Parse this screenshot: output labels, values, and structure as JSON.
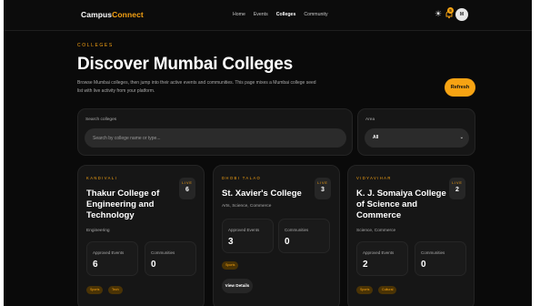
{
  "nav": {
    "brand_part1": "Campus",
    "brand_part2": "Connect",
    "links": [
      "Home",
      "Events",
      "Colleges",
      "Community"
    ],
    "active_link": "Colleges",
    "notification_count": "5",
    "avatar_initial": "M",
    "theme_icon": "sun-icon",
    "bell_icon": "bell-icon"
  },
  "header": {
    "eyebrow": "COLLEGES",
    "title": "Discover Mumbai Colleges",
    "description": "Browse Mumbai colleges, then jump into their active events and communities. This page mixes a Mumbai college seed list with live activity from your platform.",
    "refresh_label": "Refresh"
  },
  "filters": {
    "search_label": "Search colleges",
    "search_placeholder": "Search by college name or type...",
    "area_label": "Area",
    "area_value": "All"
  },
  "colors": {
    "accent": "#f7a313",
    "background": "#0a0a0a",
    "card": "#161616"
  },
  "colleges": [
    {
      "area": "KANDIVALI",
      "name": "Thakur College of Engineering and Technology",
      "type": "Engineering",
      "live_label": "LIVE",
      "live_count": "6",
      "approved_label": "Approved Events",
      "approved_value": "6",
      "communities_label": "Communities",
      "communities_value": "0",
      "tags": [
        "Sports",
        "Tech"
      ]
    },
    {
      "area": "DHOBI TALAO",
      "name": "St. Xavier's College",
      "type": "Arts, Science, Commerce",
      "live_label": "LIVE",
      "live_count": "3",
      "approved_label": "Approved Events",
      "approved_value": "3",
      "communities_label": "Communities",
      "communities_value": "0",
      "tags": [
        "Sports"
      ],
      "view_label": "View Details"
    },
    {
      "area": "VIDYAVIHAR",
      "name": "K. J. Somaiya College of Science and Commerce",
      "type": "Science, Commerce",
      "live_label": "LIVE",
      "live_count": "2",
      "approved_label": "Approved Events",
      "approved_value": "2",
      "communities_label": "Communities",
      "communities_value": "0",
      "tags": [
        "Sports",
        "Cultural"
      ]
    }
  ]
}
